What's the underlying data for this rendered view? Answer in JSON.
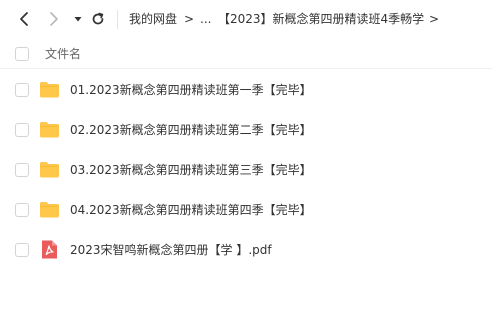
{
  "toolbar": {
    "back_icon": "chevron-left-icon",
    "forward_icon": "chevron-right-icon",
    "history_icon": "caret-down-icon",
    "refresh_icon": "refresh-icon",
    "breadcrumbs": [
      "我的网盘",
      "...",
      "【2023】新概念第四册精读班4季畅学"
    ],
    "separator": ">"
  },
  "list": {
    "header_label": "文件名",
    "items": [
      {
        "name": "01.2023新概念第四册精读班第一季【完毕】",
        "type": "folder",
        "icon": "folder-icon"
      },
      {
        "name": "02.2023新概念第四册精读班第二季【完毕】",
        "type": "folder",
        "icon": "folder-icon"
      },
      {
        "name": "03.2023新概念第四册精读班第三季【完毕】",
        "type": "folder",
        "icon": "folder-icon"
      },
      {
        "name": "04.2023新概念第四册精读班第四季【完毕】",
        "type": "folder",
        "icon": "folder-icon"
      },
      {
        "name": "2023宋智鸣新概念第四册【学 】.pdf",
        "type": "pdf",
        "icon": "pdf-file-icon"
      }
    ]
  },
  "colors": {
    "folder": "#ffc84a",
    "pdf": "#ea5b5b",
    "border": "#d4d4d4",
    "text": "#333333",
    "muted": "#666666"
  }
}
